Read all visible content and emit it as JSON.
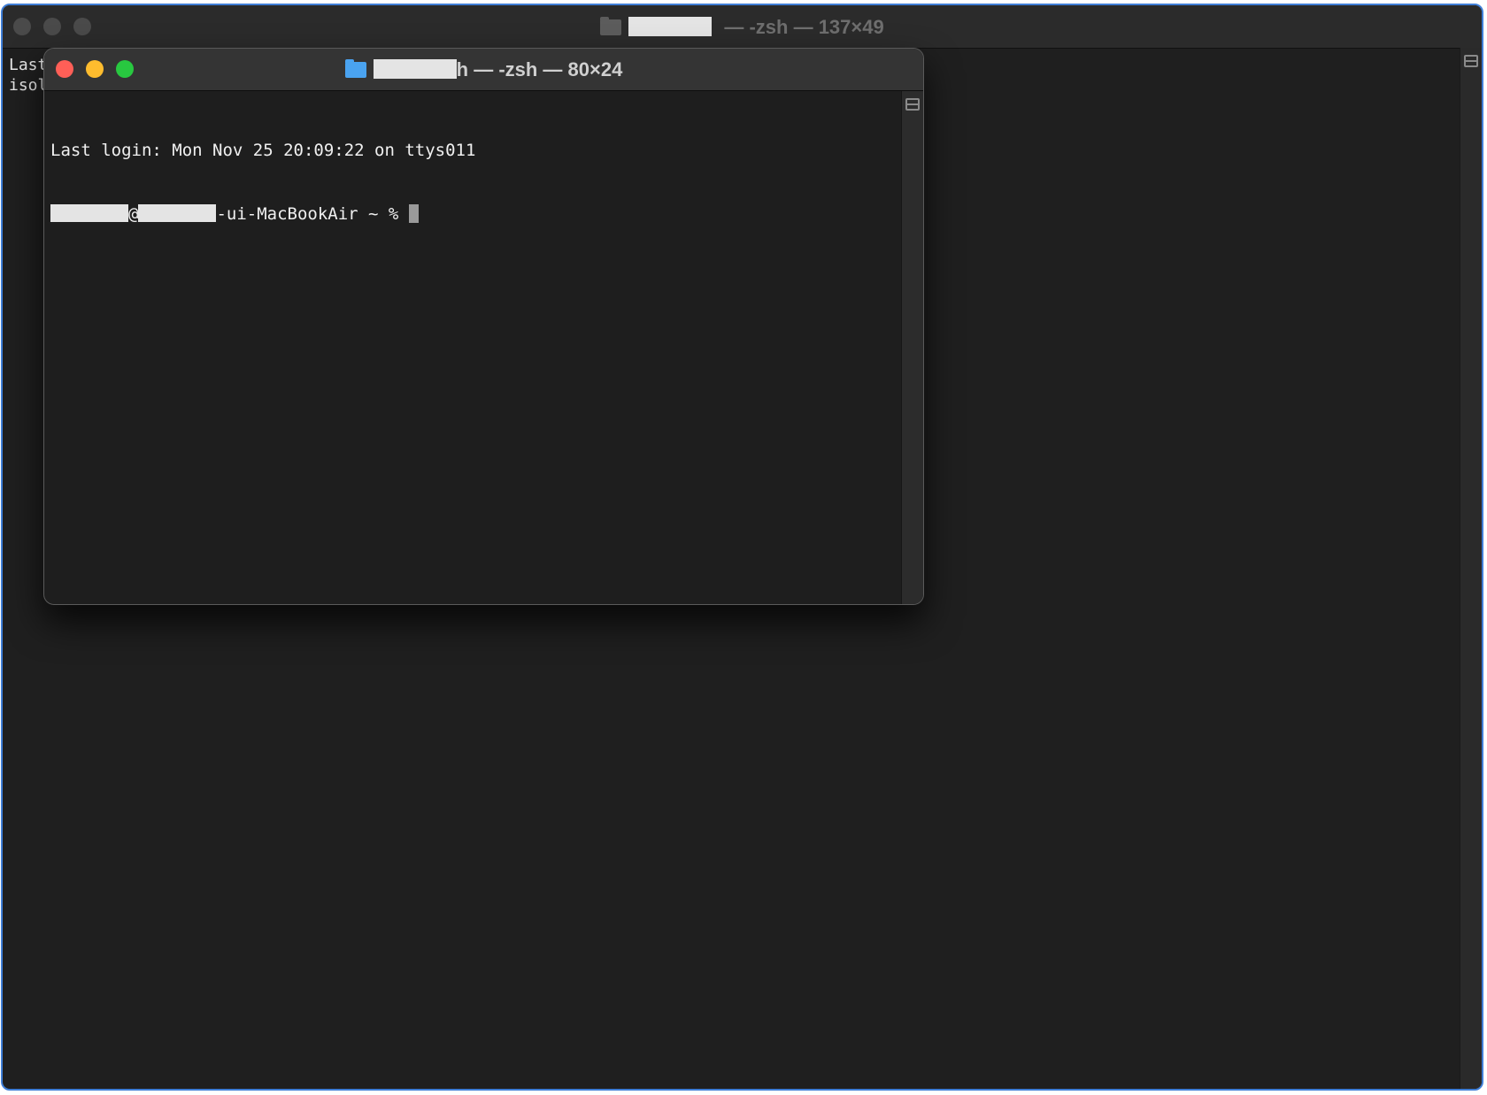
{
  "background_window": {
    "title_suffix": " — -zsh — 137×49",
    "text_lines": [
      "Last",
      "isol"
    ]
  },
  "foreground_window": {
    "title_suffix": "h — -zsh — 80×24",
    "login_line": "Last login: Mon Nov 25 20:09:22 on ttys011",
    "prompt_at": "@",
    "prompt_host_suffix": "-ui-MacBookAir ~ % "
  },
  "icons": {
    "folder": "folder-icon",
    "split_pane": "split-pane-icon"
  },
  "colors": {
    "close": "#ff5f57",
    "minimize": "#febc2e",
    "maximize": "#28c840",
    "folder_active": "#4aa3f0",
    "terminal_bg": "#1e1e1e",
    "selection_border": "#3f7ed6"
  }
}
